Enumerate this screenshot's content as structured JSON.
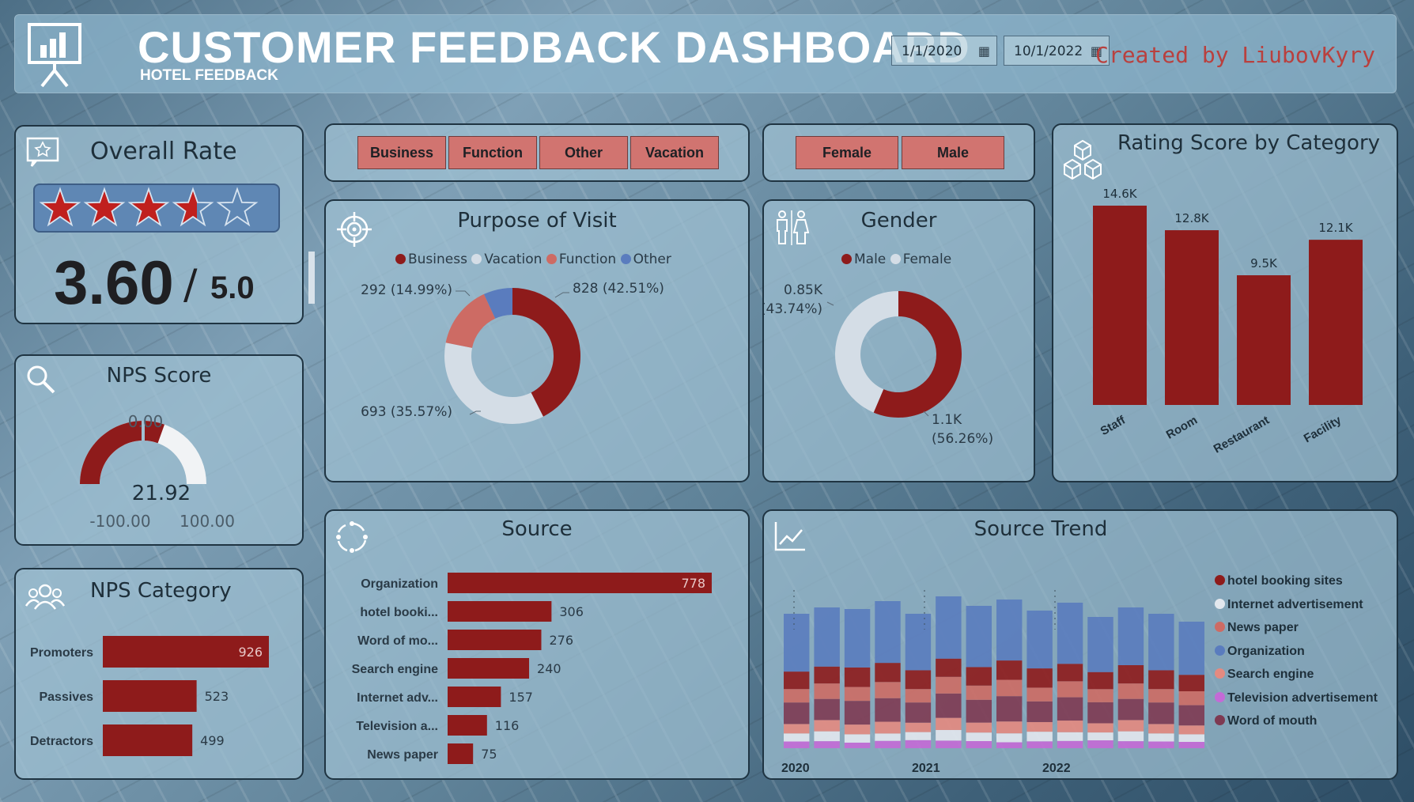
{
  "header": {
    "title": "CUSTOMER FEEDBACK DASHBOARD",
    "subtitle": "HOTEL FEEDBACK",
    "date_start": "1/1/2020",
    "date_end": "10/1/2022",
    "creator": "Created by LiubovKyry"
  },
  "overall": {
    "title": "Overall Rate",
    "value": "3.60",
    "slash": "/",
    "max": "5.0",
    "stars_total": 5,
    "stars_filled": 3.6
  },
  "nps_score": {
    "title": "NPS Score",
    "target_label": "0.00",
    "value_label": "21.92",
    "min_label": "-100.00",
    "max_label": "100.00",
    "value": 21.92,
    "min": -100,
    "max": 100,
    "target": 0
  },
  "nps_category": {
    "title": "NPS Category"
  },
  "purpose_slicer": [
    "Business",
    "Function",
    "Other",
    "Vacation"
  ],
  "gender_slicer": [
    "Female",
    "Male"
  ],
  "purpose": {
    "title": "Purpose of Visit"
  },
  "gender": {
    "title": "Gender"
  },
  "rating": {
    "title": "Rating Score by Category"
  },
  "source": {
    "title": "Source"
  },
  "trend": {
    "title": "Source Trend"
  },
  "colors": {
    "darkred": "#8e1b1b",
    "lightgray": "#d4dde6",
    "salmon": "#cd6b64",
    "blue": "#5a7cbe",
    "pink": "#e48a80",
    "violet": "#c46ad6",
    "plum": "#7e3a52",
    "panel": "#a0c0d2"
  },
  "chart_data": [
    {
      "id": "nps_category",
      "type": "bar",
      "orientation": "horizontal",
      "categories": [
        "Promoters",
        "Passives",
        "Detractors"
      ],
      "values": [
        926,
        523,
        499
      ],
      "value_labels": [
        "926",
        "523",
        "499"
      ]
    },
    {
      "id": "purpose",
      "type": "pie",
      "subtype": "donut",
      "categories": [
        "Business",
        "Vacation",
        "Function",
        "Other"
      ],
      "values": [
        828,
        693,
        292,
        134
      ],
      "value_labels": [
        "828 (42.51%)",
        "693 (35.57%)",
        "292 (14.99%)",
        ""
      ],
      "colors": [
        "#8e1b1b",
        "#d4dde6",
        "#cd6b64",
        "#5a7cbe"
      ],
      "legend": "top"
    },
    {
      "id": "gender",
      "type": "pie",
      "subtype": "donut",
      "categories": [
        "Male",
        "Female"
      ],
      "values": [
        1100,
        850
      ],
      "value_labels": [
        "1.1K",
        "(56.26%)",
        "0.85K",
        "(43.74%)"
      ],
      "colors": [
        "#8e1b1b",
        "#d4dde6"
      ],
      "legend": "top"
    },
    {
      "id": "rating",
      "type": "bar",
      "categories": [
        "Staff",
        "Room",
        "Restaurant",
        "Facility"
      ],
      "values": [
        14600,
        12800,
        9500,
        12100
      ],
      "value_labels": [
        "14.6K",
        "12.8K",
        "9.5K",
        "12.1K"
      ]
    },
    {
      "id": "source",
      "type": "bar",
      "orientation": "horizontal",
      "categories": [
        "Organization",
        "hotel booki...",
        "Word of mo...",
        "Search engine",
        "Internet adv...",
        "Television a...",
        "News paper"
      ],
      "values": [
        778,
        306,
        276,
        240,
        157,
        116,
        75
      ],
      "value_labels": [
        "778",
        "306",
        "276",
        "240",
        "157",
        "116",
        "75"
      ]
    },
    {
      "id": "trend",
      "type": "area",
      "subtype": "ribbon",
      "x_ticks": [
        "2020",
        "2021",
        "2022"
      ],
      "legend": "right",
      "series": [
        {
          "name": "hotel booking sites",
          "color": "#8e1b1b"
        },
        {
          "name": "Internet advertisement",
          "color": "#e3e8ee"
        },
        {
          "name": "News paper",
          "color": "#cd6b64"
        },
        {
          "name": "Organization",
          "color": "#5a7cbe"
        },
        {
          "name": "Search engine",
          "color": "#e48a80"
        },
        {
          "name": "Television advertisement",
          "color": "#c46ad6"
        },
        {
          "name": "Word of mouth",
          "color": "#7e3a52"
        }
      ]
    }
  ]
}
